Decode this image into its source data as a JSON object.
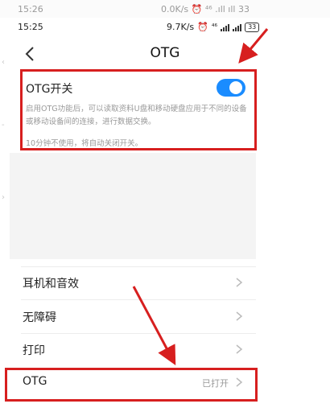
{
  "ghost_status": {
    "time": "15:26",
    "right": "0.0K/s ⏰ ⁴⁶ .ıll ıll 33"
  },
  "status": {
    "time": "15:25",
    "speed": "9.7K/s",
    "net": "⁴⁶",
    "battery": "33"
  },
  "header": {
    "title": "OTG"
  },
  "otg": {
    "label": "OTG开关",
    "enabled": true,
    "description": "启用OTG功能后，可以读取资料U盘和移动硬盘应用于不同的设备或移动设备间的连接，进行数据交换。",
    "note": "10分钟不使用，将自动关闭开关。"
  },
  "settings": [
    {
      "label": "耳机和音效",
      "value": ""
    },
    {
      "label": "无障碍",
      "value": ""
    },
    {
      "label": "打印",
      "value": ""
    },
    {
      "label": "OTG",
      "value": "已打开"
    }
  ],
  "colors": {
    "accent": "#1a8cff",
    "highlight": "#d71f1f"
  },
  "icons": [
    "back-arrow-icon",
    "alarm-icon",
    "signal-icon",
    "battery-icon",
    "chevron-right-icon"
  ]
}
